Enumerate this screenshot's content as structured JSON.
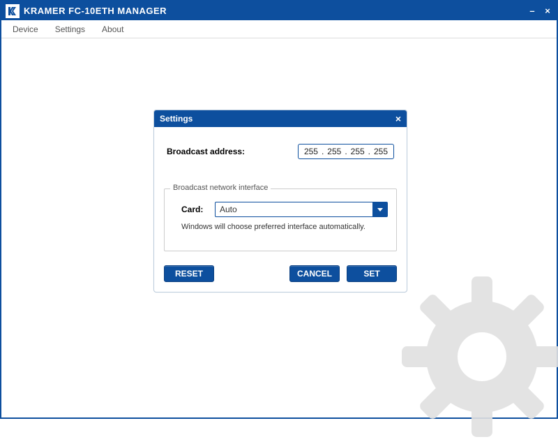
{
  "app_title": "KRAMER  FC-10ETH  MANAGER",
  "menu": {
    "device": "Device",
    "settings": "Settings",
    "about": "About"
  },
  "dialog": {
    "title": "Settings",
    "broadcast_label": "Broadcast address:",
    "ip": {
      "o1": "255",
      "o2": "255",
      "o3": "255",
      "o4": "255"
    },
    "fieldset_legend": "Broadcast network interface",
    "card_label": "Card:",
    "card_value": "Auto",
    "hint": "Windows will choose preferred interface automatically.",
    "buttons": {
      "reset": "RESET",
      "cancel": "CANCEL",
      "set": "SET"
    }
  }
}
